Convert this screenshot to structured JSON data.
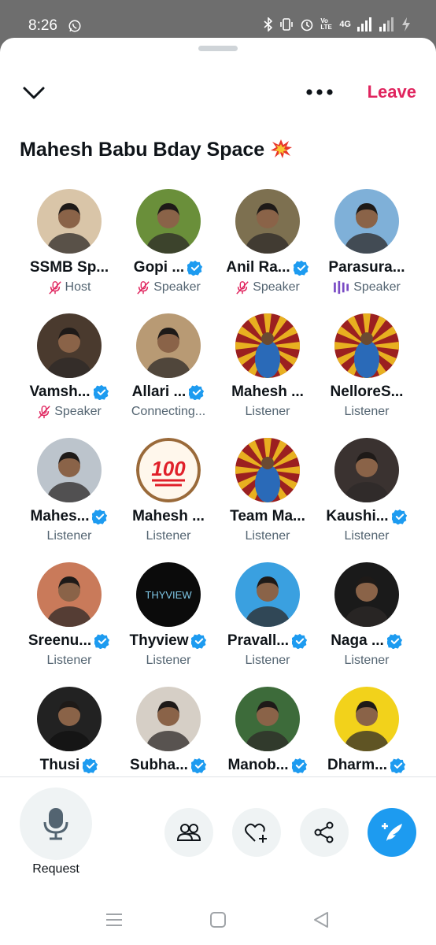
{
  "status": {
    "time": "8:26",
    "network": "4G",
    "volte": "Vo LTE"
  },
  "header": {
    "leave_label": "Leave"
  },
  "space": {
    "title": "Mahesh Babu Bday Space",
    "title_emoji": "collision-emoji"
  },
  "participants": [
    {
      "name": "SSMB Sp...",
      "role": "Host",
      "verified": false,
      "role_icon": "mic-off-icon",
      "avatar_color": "#d9c5a8"
    },
    {
      "name": "Gopi ...",
      "role": "Speaker",
      "verified": true,
      "role_icon": "mic-off-icon",
      "avatar_color": "#6a8f3a"
    },
    {
      "name": "Anil Ra...",
      "role": "Speaker",
      "verified": true,
      "role_icon": "mic-off-icon",
      "avatar_color": "#7d7050"
    },
    {
      "name": "Parasura...",
      "role": "Speaker",
      "verified": false,
      "role_icon": "sound-bars-icon",
      "avatar_color": "#7fb0d8"
    },
    {
      "name": "Vamsh...",
      "role": "Speaker",
      "verified": true,
      "role_icon": "mic-off-icon",
      "avatar_color": "#4a3a2e"
    },
    {
      "name": "Allari ...",
      "role": "Connecting...",
      "verified": true,
      "role_icon": "",
      "avatar_color": "#b89a74"
    },
    {
      "name": "Mahesh ...",
      "role": "Listener",
      "verified": false,
      "role_icon": "",
      "avatar_color": "#9b2020"
    },
    {
      "name": "NelloreS...",
      "role": "Listener",
      "verified": false,
      "role_icon": "",
      "avatar_color": "#9b2020"
    },
    {
      "name": "Mahes...",
      "role": "Listener",
      "verified": true,
      "role_icon": "",
      "avatar_color": "#bcc4cc"
    },
    {
      "name": "Mahesh ...",
      "role": "Listener",
      "verified": false,
      "role_icon": "",
      "avatar_color": "#fff7ec"
    },
    {
      "name": "Team Ma...",
      "role": "Listener",
      "verified": false,
      "role_icon": "",
      "avatar_color": "#9b2020"
    },
    {
      "name": "Kaushi...",
      "role": "Listener",
      "verified": true,
      "role_icon": "",
      "avatar_color": "#3a3230"
    },
    {
      "name": "Sreenu...",
      "role": "Listener",
      "verified": true,
      "role_icon": "",
      "avatar_color": "#c97a5a"
    },
    {
      "name": "Thyview",
      "role": "Listener",
      "verified": true,
      "role_icon": "",
      "avatar_color": "#0b0b0b"
    },
    {
      "name": "Pravall...",
      "role": "Listener",
      "verified": true,
      "role_icon": "",
      "avatar_color": "#3aa0e0"
    },
    {
      "name": "Naga ...",
      "role": "Listener",
      "verified": true,
      "role_icon": "",
      "avatar_color": "#1a1a1a"
    },
    {
      "name": "Thusi",
      "role": "",
      "verified": true,
      "role_icon": "",
      "avatar_color": "#222222"
    },
    {
      "name": "Subha...",
      "role": "",
      "verified": true,
      "role_icon": "",
      "avatar_color": "#d6cfc6"
    },
    {
      "name": "Manob...",
      "role": "",
      "verified": true,
      "role_icon": "",
      "avatar_color": "#3d6b3a"
    },
    {
      "name": "Dharm...",
      "role": "",
      "verified": true,
      "role_icon": "",
      "avatar_color": "#f2d21b"
    }
  ],
  "avatar_text": {
    "hundred": "100",
    "thyview": "THYVIEW"
  },
  "footer": {
    "request_label": "Request"
  },
  "colors": {
    "accent": "#1d9bf0",
    "leave": "#e0245e",
    "mute": "#e0245e",
    "speaking": "#794bc4",
    "muted_text": "#536471"
  }
}
